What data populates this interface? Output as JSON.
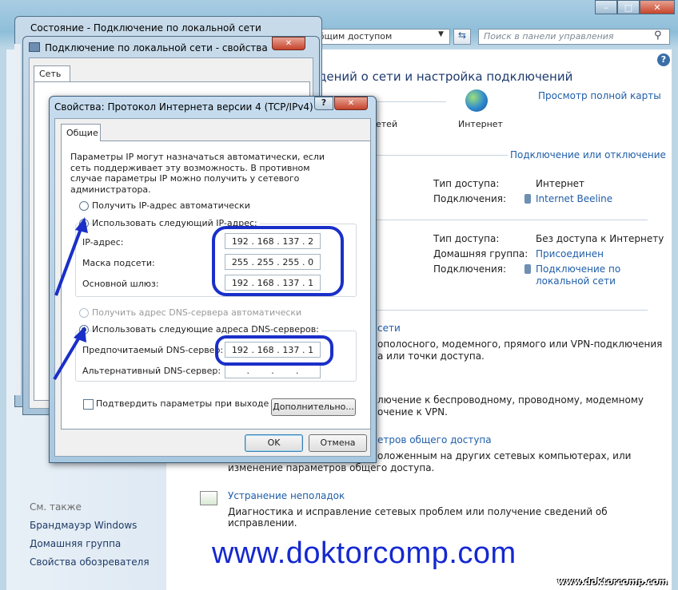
{
  "control_panel": {
    "address": "общим доступом",
    "search_placeholder": "Поиск в панели управления",
    "heading": "дений о сети и настройка подключений",
    "view_full_map": "Просмотр полной карты",
    "map_left_label": "етей",
    "map_internet_label": "Интернет",
    "connect_disconnect": "Подключение или отключение",
    "net1": {
      "access_type_label": "Тип доступа:",
      "access_type_value": "Интернет",
      "connections_label": "Подключения:",
      "connections_value": "Internet Beeline"
    },
    "net2": {
      "access_type_label": "Тип доступа:",
      "access_type_value": "Без доступа к Интернету",
      "homegroup_label": "Домашняя группа:",
      "homegroup_value": "Присоединен",
      "connections_label": "Подключения:",
      "connections_value_1": "Подключение по",
      "connections_value_2": "локальной сети"
    },
    "section1_title": "сети",
    "section1_desc_1": "ополосного, модемного, прямого или VPN-подключения",
    "section1_desc_2": "а или точки доступа.",
    "section2_desc_1": "лючение к беспроводному, проводному, модемному",
    "section2_desc_2": "очение к VPN.",
    "section3_title": "етров общего доступа",
    "section3_desc_1": "оложенным на других сетевых компьютерах, или",
    "section3_desc_2": "изменение параметров общего доступа.",
    "trouble_title": "Устранение неполадок",
    "trouble_desc": "Диагностика и исправление сетевых проблем или получение сведений об исправлении.",
    "see_also": "См. также",
    "left_links": [
      "Брандмауэр Windows",
      "Домашняя группа",
      "Свойства обозревателя"
    ]
  },
  "status_window": {
    "title": "Состояние - Подключение по локальной сети"
  },
  "props_window": {
    "title": "Подключение по локальной сети - свойства",
    "tab": "Сеть"
  },
  "ipv4_dialog": {
    "title": "Свойства: Протокол Интернета версии 4 (TCP/IPv4)",
    "help_btn": "?",
    "tab": "Общие",
    "description": "Параметры IP могут назначаться автоматически, если сеть поддерживает эту возможность. В противном случае параметры IP можно получить у сетевого администратора.",
    "radio_auto_ip": "Получить IP-адрес автоматически",
    "radio_manual_ip": "Использовать следующий IP-адрес:",
    "ip_label": "IP-адрес:",
    "ip_value": [
      "192",
      "168",
      "137",
      "2"
    ],
    "mask_label": "Маска подсети:",
    "mask_value": [
      "255",
      "255",
      "255",
      "0"
    ],
    "gateway_label": "Основной шлюз:",
    "gateway_value": [
      "192",
      "168",
      "137",
      "1"
    ],
    "radio_auto_dns": "Получить адрес DNS-сервера автоматически",
    "radio_manual_dns": "Использовать следующие адреса DNS-серверов:",
    "pref_dns_label": "Предпочитаемый DNS-сервер:",
    "pref_dns_value": [
      "192",
      "168",
      "137",
      "1"
    ],
    "alt_dns_label": "Альтернативный DNS-сервер:",
    "alt_dns_value": [
      "",
      "",
      "",
      ""
    ],
    "confirm_on_exit": "Подтвердить параметры при выходе",
    "advanced_btn": "Дополнительно...",
    "ok_btn": "OK",
    "cancel_btn": "Отмена"
  },
  "watermark": {
    "big": "www.doktorcomp.com",
    "small": "www.doktorcomp.com"
  },
  "colors": {
    "annotation": "#1a2fc8",
    "link": "#1f5ea8"
  }
}
